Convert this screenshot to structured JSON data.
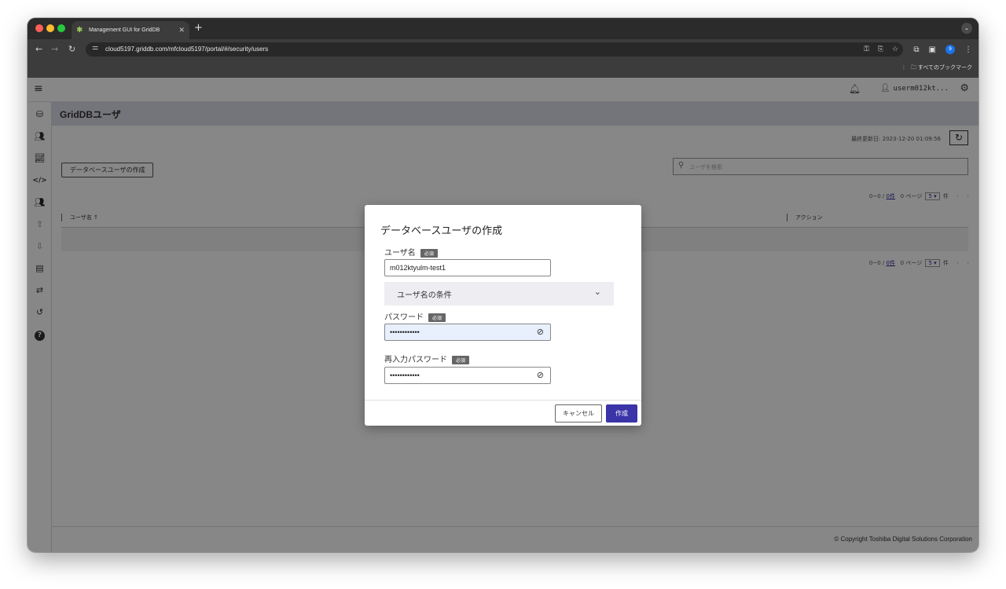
{
  "browser": {
    "tab_title": "Management GUI for GridDB",
    "url": "cloud5197.griddb.com/mfcloud5197/portal/#/security/users",
    "bookmarks_label": "すべてのブックマーク",
    "profile_initial": "9"
  },
  "app": {
    "username": "userm012kt...",
    "page_title": "GridDBユーザ",
    "last_updated": "最終更新日: 2023-12-20 01:09:56",
    "create_db_user_button": "データベースユーザの作成",
    "search_placeholder": "ユーザを検索",
    "pager": {
      "range_prefix": "0~0 / ",
      "count": "0件",
      "page": "0 ページ",
      "per_page": "5",
      "unit": "件"
    },
    "table": {
      "col_username": "ユーザ名 ↑",
      "col_action": "アクション"
    },
    "footer": "© Copyright Toshiba Digital Solutions Corporation"
  },
  "modal": {
    "title": "データベースユーザの作成",
    "username_label": "ユーザ名",
    "required_badge": "必須",
    "username_value": "m012ktyulm-test1",
    "conditions_label": "ユーザ名の条件",
    "password_label": "パスワード",
    "password_value": "••••••••••••",
    "repassword_label": "再入力パスワード",
    "repassword_value": "••••••••••••",
    "cancel_label": "キャンセル",
    "create_label": "作成"
  },
  "colors": {
    "primary": "#3b33a8",
    "header_bg": "#dcdce8"
  },
  "icons": [
    "hamburger-icon",
    "bell-icon",
    "person-icon",
    "gear-icon",
    "database-icon",
    "users-icon",
    "chart-icon",
    "code-icon",
    "users-security-icon",
    "upload-icon",
    "download-icon",
    "document-icon",
    "shuffle-icon",
    "history-icon",
    "help-icon",
    "refresh-icon",
    "search-icon",
    "chevron-down-icon",
    "eye-off-icon"
  ]
}
